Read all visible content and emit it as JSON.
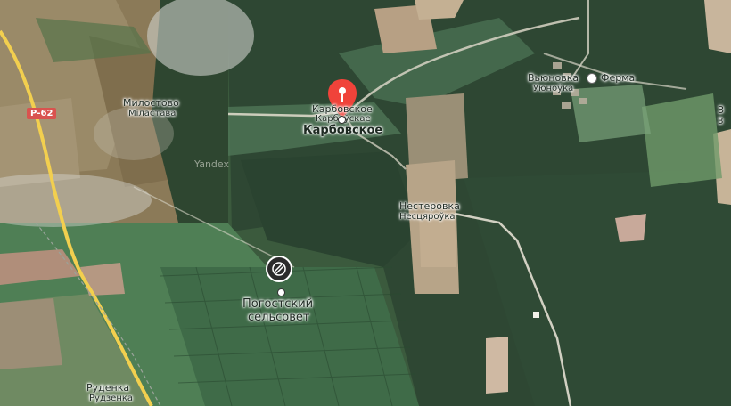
{
  "map": {
    "attribution": "Yandex",
    "road_badge": "Р-62",
    "places": {
      "milostovo_ru": "Милостово",
      "milostovo_by": "Міластава",
      "karbovskoe_top": "Карбовское",
      "karbovskoe_by": "Карбоўскае",
      "karbovskoe_selected": "Карбовское",
      "vyunovka_ru": "Вьюновка",
      "vyunovka_by": "Уюноўка",
      "ferma": "Ферма",
      "nesterovka_ru": "Нестеровка",
      "nesterovka_by": "Несцяроўка",
      "pogost_line1": "Погостский",
      "pogost_line2": "сельсовет",
      "rudenka_ru": "Руденка",
      "rudenka_by": "Рудзенка",
      "edge_3": "З",
      "edge_3b": "З"
    }
  },
  "colors": {
    "pin": "#f0433a",
    "road_yellow": "#f2cf4f",
    "forest_dark": "#2f4a33",
    "field": "#b9a58a"
  }
}
